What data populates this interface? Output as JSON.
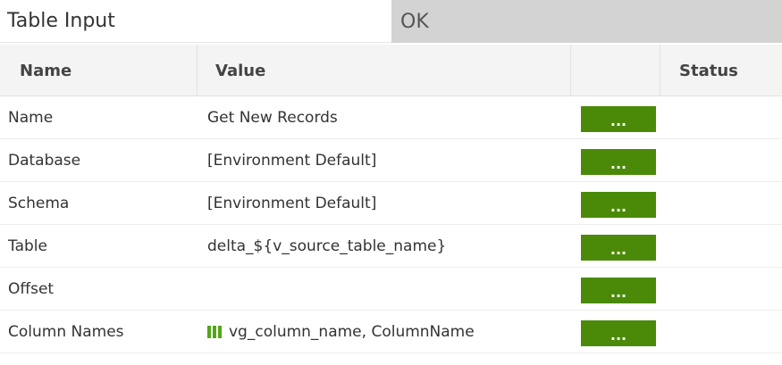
{
  "dialog": {
    "title": "Table Input",
    "ok_label": "OK"
  },
  "table": {
    "headers": {
      "name": "Name",
      "value": "Value",
      "action": "",
      "status": "Status"
    },
    "rows": [
      {
        "name": "Name",
        "value": "Get New Records",
        "has_variable_icon": false,
        "button": "...",
        "status": ""
      },
      {
        "name": "Database",
        "value": "[Environment Default]",
        "has_variable_icon": false,
        "button": "...",
        "status": ""
      },
      {
        "name": "Schema",
        "value": "[Environment Default]",
        "has_variable_icon": false,
        "button": "...",
        "status": ""
      },
      {
        "name": "Table",
        "value": "delta_${v_source_table_name}",
        "has_variable_icon": false,
        "button": "...",
        "status": ""
      },
      {
        "name": "Offset",
        "value": "",
        "has_variable_icon": false,
        "button": "...",
        "status": ""
      },
      {
        "name": "Column Names",
        "value": "vg_column_name, ColumnName",
        "has_variable_icon": true,
        "button": "...",
        "status": ""
      }
    ]
  },
  "colors": {
    "button_green": "#4b8a09",
    "variable_icon_green": "#55a51c",
    "ok_bar": "#d3d3d3",
    "header_bg": "#f4f4f4"
  }
}
